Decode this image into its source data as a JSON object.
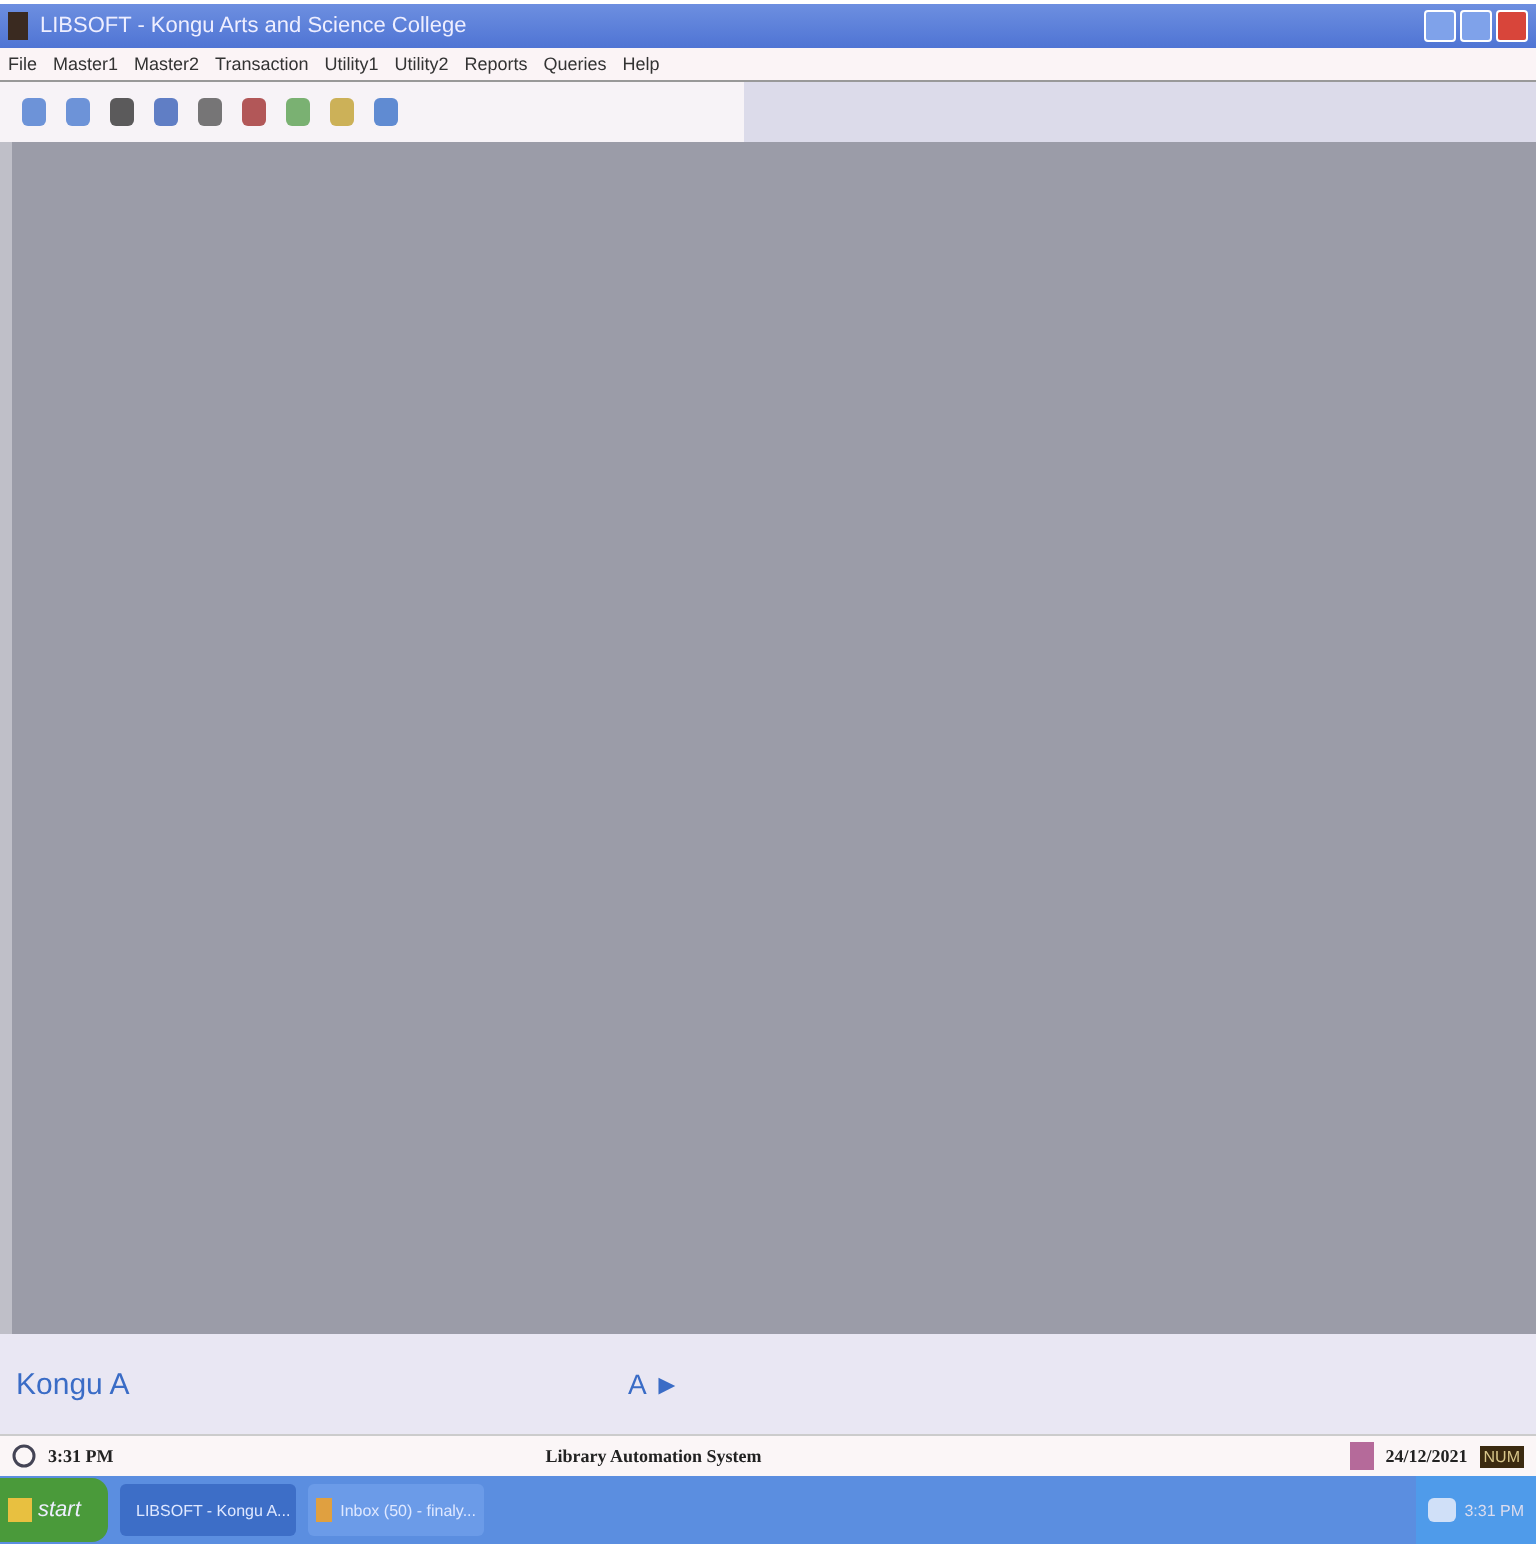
{
  "window": {
    "title": "LIBSOFT - Kongu Arts and Science College"
  },
  "menu": [
    "File",
    "Master1",
    "Master2",
    "Transaction",
    "Utility1",
    "Utility2",
    "Reports",
    "Queries",
    "Help"
  ],
  "bottom_panel": {
    "left_text": "Kongu A",
    "center_text": "A ►"
  },
  "status_bar": {
    "time": "3:31 PM",
    "title": "Library Automation System",
    "date": "24/12/2021",
    "indicator": "NUM"
  },
  "taskbar": {
    "start": "start",
    "tasks": [
      {
        "label": "LIBSOFT - Kongu A...",
        "selected": true
      },
      {
        "label": "Inbox (50) - finaly...",
        "selected": false
      }
    ],
    "clock": "3:31 PM"
  }
}
